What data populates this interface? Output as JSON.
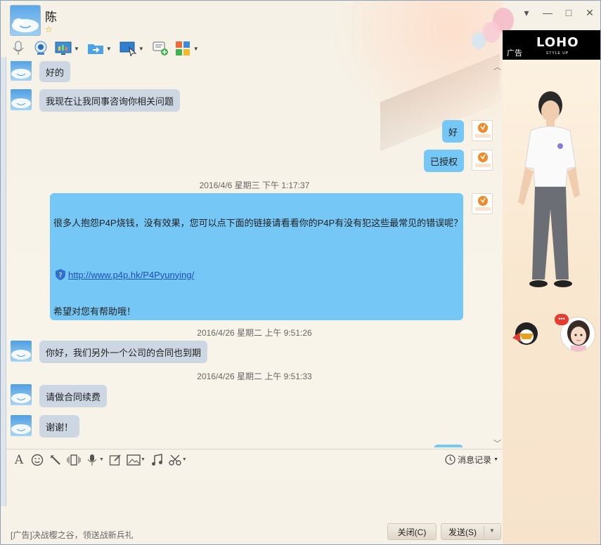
{
  "contact": {
    "name": "陈",
    "star": "☆"
  },
  "window_controls": {
    "dropdown": "▾",
    "minimize": "—",
    "maximize": "□",
    "close": "✕"
  },
  "ad": {
    "label": "广告",
    "brand": "LOHO",
    "brand_sub": "STYLE UP"
  },
  "messages": {
    "m1": "好的",
    "m2": "我现在让我同事咨询你相关问题",
    "m3": "好",
    "m4": "已授权",
    "ts1": "2016/4/6 星期三 下午 1:17:37",
    "big_line1": "很多人抱怨P4P烧钱，没有效果，您可以点下面的链接请看看你的P4P有没有犯这些最常见的错误呢？",
    "big_link": "http://www.p4p.hk/P4Pyunying/",
    "big_line3": "希望对您有帮助哦！",
    "ts2": "2016/4/26 星期二 上午 9:51:26",
    "m5": "你好，我们另外一个公司的合同也到期",
    "ts3": "2016/4/26 星期二 上午 9:51:33",
    "m6": "请做合同续费",
    "m7": "谢谢！"
  },
  "input_toolbar": {
    "history": "消息记录"
  },
  "footer": {
    "ad_text": "[广告]决战樱之谷，领送战新兵礼",
    "close": "关闭(C)",
    "send": "发送(S)"
  },
  "colors": {
    "bubble_in": "#cdd7e4",
    "bubble_out": "#75c7f6",
    "window_bg": "#f6f1e6"
  }
}
